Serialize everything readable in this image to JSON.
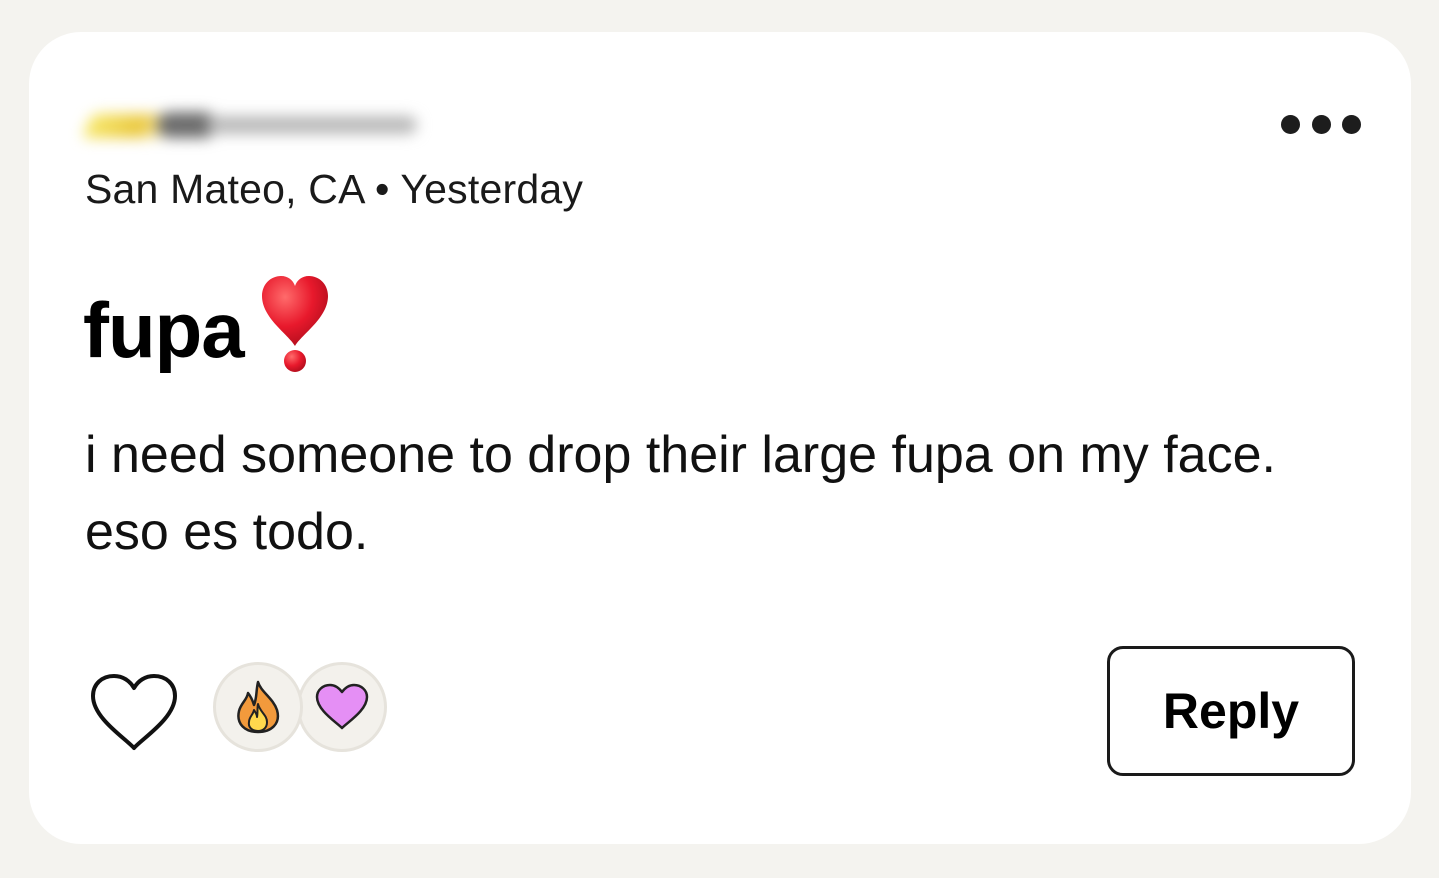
{
  "post": {
    "location": "San Mateo, CA",
    "separator": "•",
    "time": "Yesterday",
    "title": "fupa",
    "title_emoji": "heavy-heart-exclamation-icon",
    "body": "i need someone to drop their large fupa on my face. eso es todo."
  },
  "actions": {
    "reply_label": "Reply",
    "like_icon": "heart-outline-icon",
    "more_icon": "more-dots-icon"
  },
  "reactions": [
    {
      "icon": "fire-icon"
    },
    {
      "icon": "purple-heart-icon"
    }
  ],
  "colors": {
    "background": "#f4f3ef",
    "card": "#ffffff",
    "text": "#111111",
    "exclaim_red": "#e8192c",
    "reaction_heart": "#e58ff5"
  }
}
